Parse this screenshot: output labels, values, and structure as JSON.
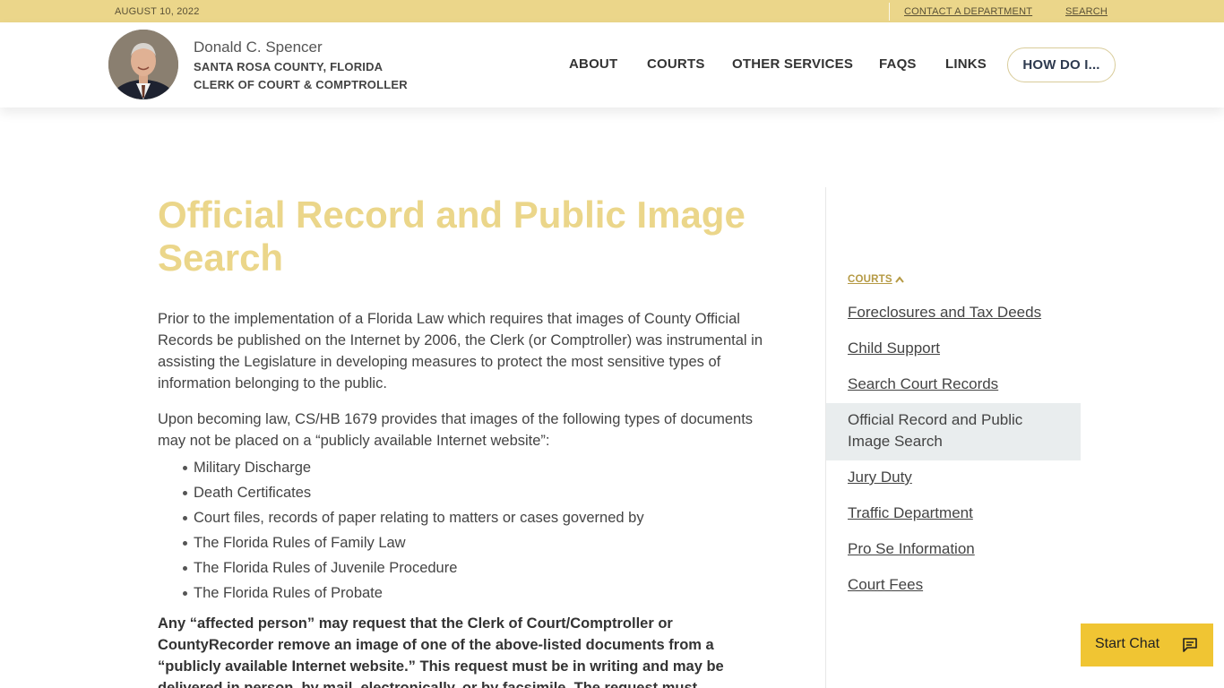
{
  "topbar": {
    "date": "AUGUST 10, 2022",
    "contact": "CONTACT A DEPARTMENT",
    "search": "SEARCH"
  },
  "header": {
    "name": "Donald C. Spencer",
    "line1": "SANTA ROSA COUNTY, FLORIDA",
    "line2": "CLERK OF COURT & COMPTROLLER",
    "nav": [
      "ABOUT",
      "COURTS",
      "OTHER SERVICES",
      "FAQS",
      "LINKS"
    ],
    "howdo": "HOW DO I..."
  },
  "main": {
    "title": "Official Record and Public Image Search",
    "p1": "Prior to the implementation of a Florida Law which requires that images of County Official Records be published on the Internet by 2006, the Clerk (or Comptroller) was instrumental in assisting the Legislature in developing measures to protect the most sensitive types of information belonging to the public.",
    "p2": "Upon becoming law, CS/HB 1679 provides that images of the following types of documents may not be placed on a “publicly available Internet website”:",
    "list": [
      "Military Discharge",
      "Death Certificates",
      "Court files, records of paper relating to matters or cases governed by",
      "The Florida Rules of Family Law",
      "The Florida Rules of Juvenile Procedure",
      "The Florida Rules of Probate"
    ],
    "p3": "Any “affected person” may request that the Clerk of Court/Comptroller or CountyRecorder remove an image of one of the above-listed documents from a “publicly available Internet website.” This request must be in writing and may be delivered in person, by mail, electronically, or by facsimile. The request must"
  },
  "sidebar": {
    "heading": "COURTS",
    "items": [
      "Foreclosures and Tax Deeds",
      "Child Support",
      "Search Court Records",
      "Official Record and Public Image Search",
      "Jury Duty",
      "Traffic Department",
      "Pro Se Information",
      "Court Fees"
    ]
  },
  "chat": {
    "label": "Start Chat"
  },
  "colors": {
    "gold": "#ebd68a",
    "accent": "#f0c533",
    "active_bg": "#e9edee"
  }
}
